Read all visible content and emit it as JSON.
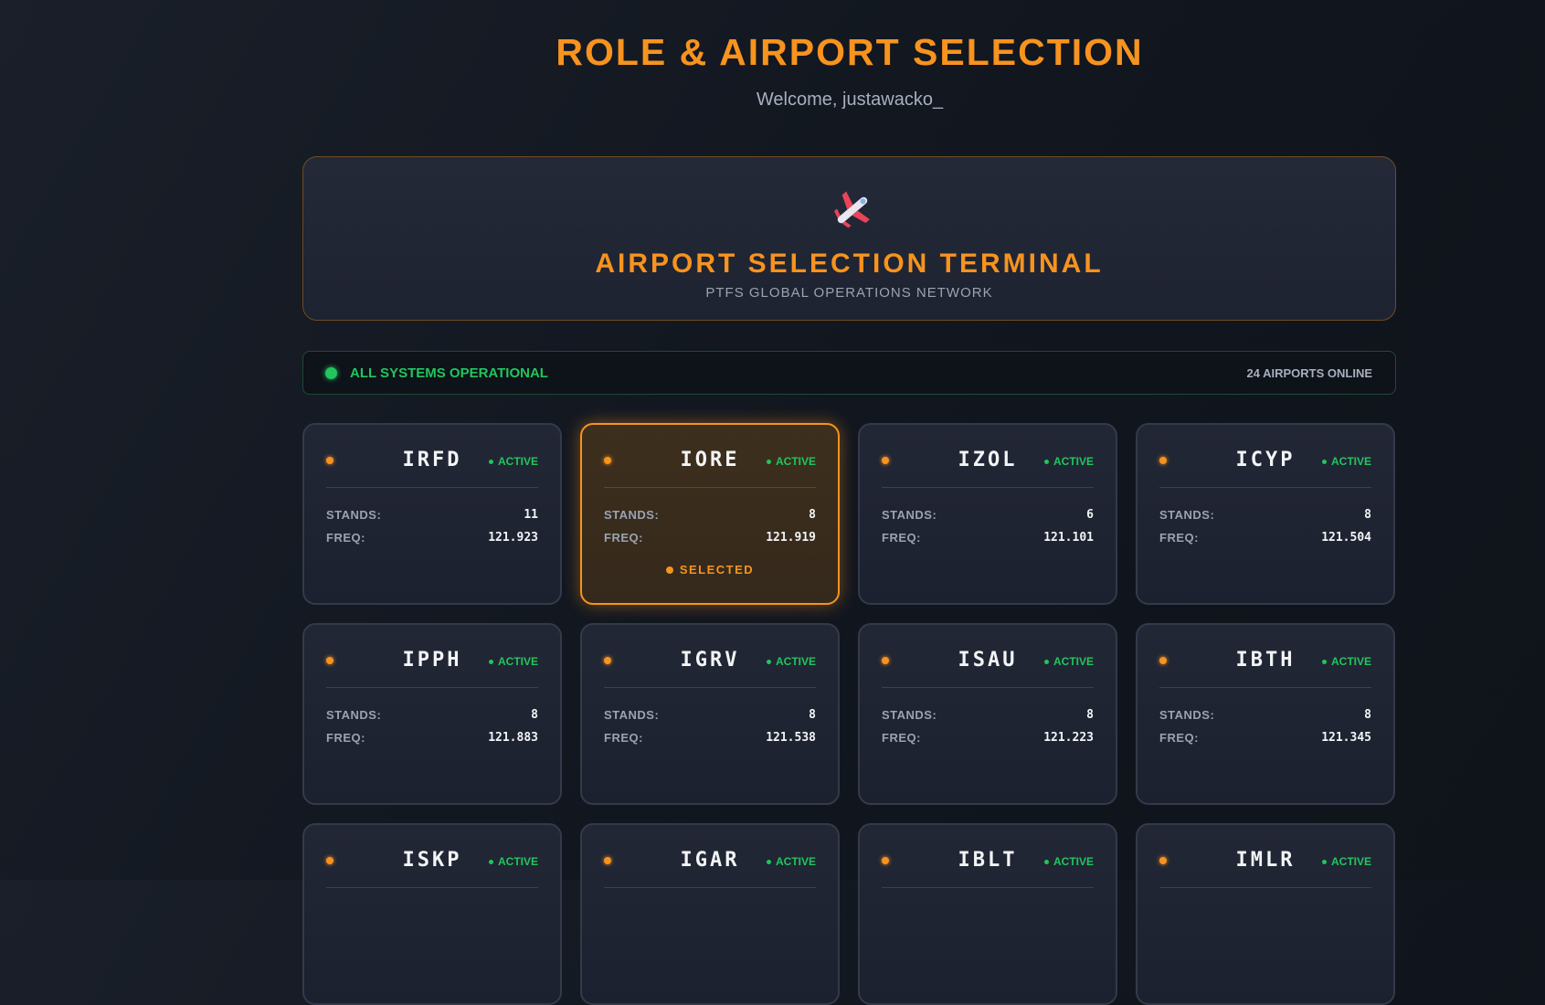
{
  "header": {
    "title": "ROLE & AIRPORT SELECTION",
    "welcome": "Welcome, justawacko_"
  },
  "terminal": {
    "icon": "airplane-icon",
    "title": "AIRPORT SELECTION TERMINAL",
    "subtitle": "PTFS GLOBAL OPERATIONS NETWORK"
  },
  "status": {
    "text": "ALL SYSTEMS OPERATIONAL",
    "count": "24 AIRPORTS ONLINE",
    "color": "#22c55e"
  },
  "labels": {
    "stands": "STANDS:",
    "freq": "FREQ:",
    "active": "ACTIVE",
    "selected": "SELECTED"
  },
  "colors": {
    "accent": "#f7931e",
    "active": "#22c55e"
  },
  "airports": [
    {
      "code": "IRFD",
      "stands": "11",
      "freq": "121.923",
      "status": "ACTIVE",
      "selected": false
    },
    {
      "code": "IORE",
      "stands": "8",
      "freq": "121.919",
      "status": "ACTIVE",
      "selected": true
    },
    {
      "code": "IZOL",
      "stands": "6",
      "freq": "121.101",
      "status": "ACTIVE",
      "selected": false
    },
    {
      "code": "ICYP",
      "stands": "8",
      "freq": "121.504",
      "status": "ACTIVE",
      "selected": false
    },
    {
      "code": "IPPH",
      "stands": "8",
      "freq": "121.883",
      "status": "ACTIVE",
      "selected": false
    },
    {
      "code": "IGRV",
      "stands": "8",
      "freq": "121.538",
      "status": "ACTIVE",
      "selected": false
    },
    {
      "code": "ISAU",
      "stands": "8",
      "freq": "121.223",
      "status": "ACTIVE",
      "selected": false
    },
    {
      "code": "IBTH",
      "stands": "8",
      "freq": "121.345",
      "status": "ACTIVE",
      "selected": false
    },
    {
      "code": "ISKP",
      "stands": "",
      "freq": "",
      "status": "ACTIVE",
      "selected": false
    },
    {
      "code": "IGAR",
      "stands": "",
      "freq": "",
      "status": "ACTIVE",
      "selected": false
    },
    {
      "code": "IBLT",
      "stands": "",
      "freq": "",
      "status": "ACTIVE",
      "selected": false
    },
    {
      "code": "IMLR",
      "stands": "",
      "freq": "",
      "status": "ACTIVE",
      "selected": false
    }
  ]
}
